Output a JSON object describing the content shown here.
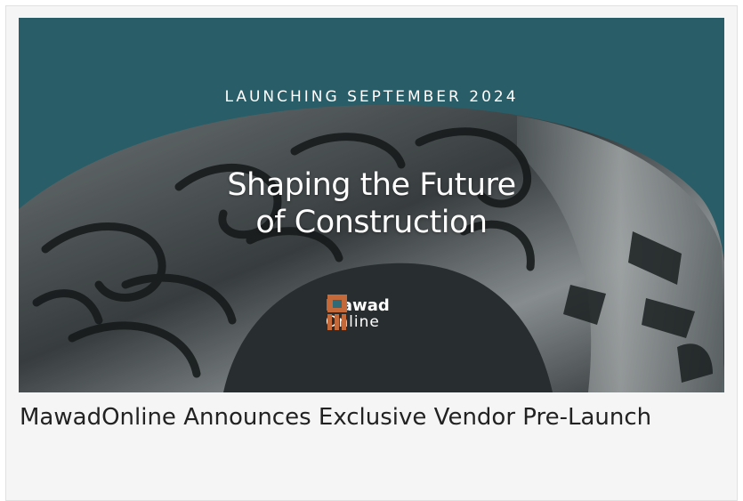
{
  "article_card": {
    "banner": {
      "tagline": "LAUNCHING SEPTEMBER 2024",
      "headline_line1": "Shaping the Future",
      "headline_line2": "of Construction",
      "logo": {
        "brand": "Mawad",
        "sub": "Online"
      },
      "background_color": "#2f6a76",
      "logo_accent_color": "#c46a3a",
      "image_subject": "museum-of-the-future-building-icon"
    },
    "title": "MawadOnline Announces Exclusive Vendor Pre-Launch"
  }
}
